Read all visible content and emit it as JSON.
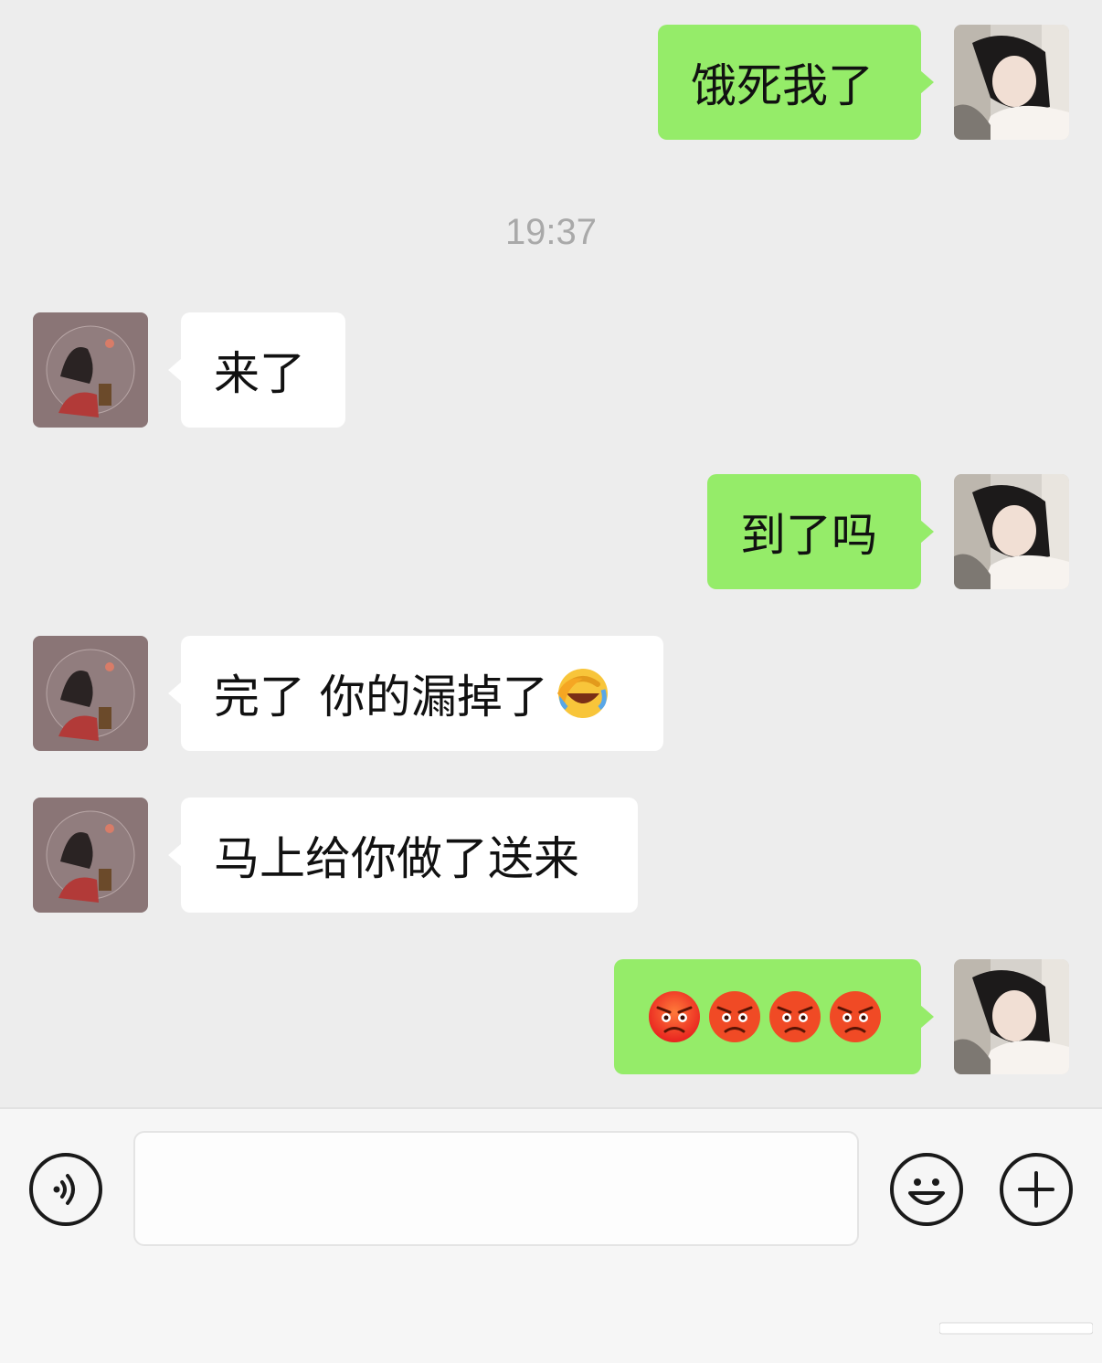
{
  "messages": [
    {
      "side": "me",
      "text": "饿死我了"
    },
    {
      "side": "other",
      "text": "来了"
    },
    {
      "side": "me",
      "text": "到了吗"
    },
    {
      "side": "other",
      "text": "完了 你的漏掉了",
      "emoji": "face-with-tears-of-joy-covering-face"
    },
    {
      "side": "other",
      "text": "马上给你做了送来"
    },
    {
      "side": "me",
      "emojis": [
        "angry-red-face",
        "angry-red-face",
        "angry-red-face",
        "angry-red-face"
      ]
    }
  ],
  "timestamp": "19:37",
  "composer": {
    "placeholder": "",
    "left_icon": "voice-icon",
    "right_icons": [
      "emoji-icon",
      "plus-icon"
    ]
  },
  "colors": {
    "background": "#ededed",
    "my_bubble": "#95ec69",
    "other_bubble": "#ffffff",
    "timestamp": "#a9a9a9"
  }
}
